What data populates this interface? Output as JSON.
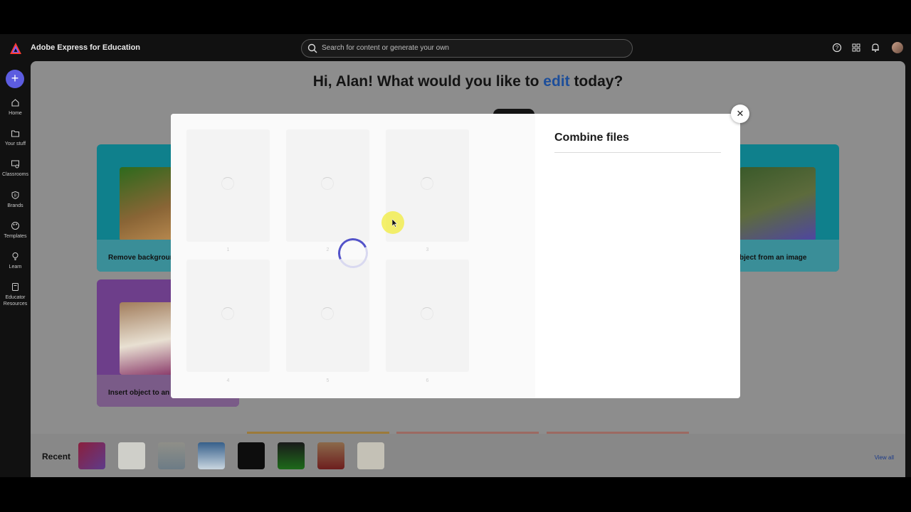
{
  "app": {
    "title": "Adobe Express for Education"
  },
  "search": {
    "placeholder": "Search for content or generate your own"
  },
  "rail": {
    "items": [
      {
        "label": "Home",
        "icon": "home-icon"
      },
      {
        "label": "Your stuff",
        "icon": "folder-icon"
      },
      {
        "label": "Classrooms",
        "icon": "classrooms-icon"
      },
      {
        "label": "Brands",
        "icon": "brands-icon"
      },
      {
        "label": "Templates",
        "icon": "templates-icon"
      },
      {
        "label": "Learn",
        "icon": "lightbulb-icon"
      },
      {
        "label": "Educator Resources",
        "icon": "book-icon"
      }
    ]
  },
  "hero": {
    "prefix": "Hi, Alan! What would you like to ",
    "highlight": "edit",
    "suffix": " today?"
  },
  "cards": {
    "remove_bg": "Remove backgroun",
    "insert_obj": "Insert object to an i",
    "remove_obj": "bject from an image"
  },
  "recent": {
    "label": "Recent",
    "view_all": "View all"
  },
  "modal": {
    "title": "Combine files",
    "pages": [
      "1",
      "2",
      "3",
      "4",
      "5",
      "6"
    ]
  },
  "colors": {
    "accent": "#5353c9",
    "highlight": "#1d4e9a"
  }
}
